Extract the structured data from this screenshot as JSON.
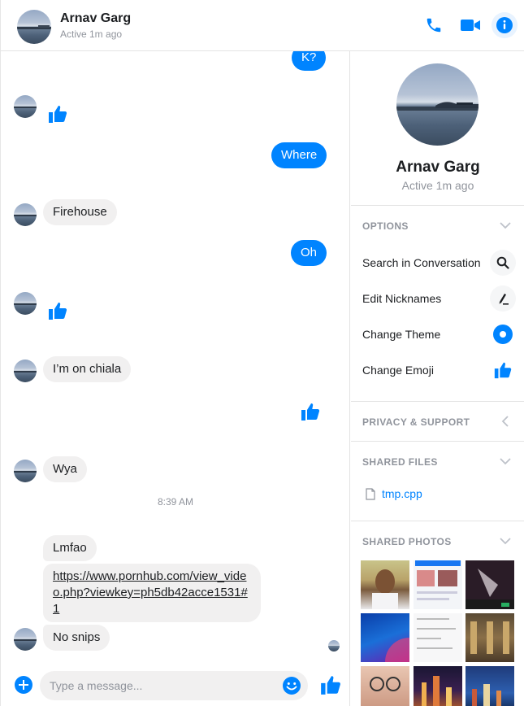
{
  "header": {
    "name": "Arnav Garg",
    "status": "Active 1m ago"
  },
  "messages": {
    "out_k": "K?",
    "out_where": "Where",
    "in_firehouse": "Firehouse",
    "out_oh": "Oh",
    "in_chiala": "I’m on chiala",
    "in_wya": "Wya",
    "timestamp": "8:39 AM",
    "in_lmfao": "Lmfao",
    "in_link": "https://www.pornhub.com/view_video.php?viewkey=ph5db42acce1531#1",
    "in_nosnips": "No snips"
  },
  "composer": {
    "placeholder": "Type a message..."
  },
  "panel": {
    "name": "Arnav Garg",
    "status": "Active 1m ago",
    "options_title": "OPTIONS",
    "options": [
      {
        "label": "Search in Conversation",
        "icon": "search-icon"
      },
      {
        "label": "Edit Nicknames",
        "icon": "pencil-icon"
      },
      {
        "label": "Change Theme",
        "icon": "theme-icon"
      },
      {
        "label": "Change Emoji",
        "icon": "thumbs-up-icon"
      }
    ],
    "privacy_title": "PRIVACY & SUPPORT",
    "files_title": "SHARED FILES",
    "files": [
      {
        "name": "tmp.cpp"
      }
    ],
    "photos_title": "SHARED PHOTOS"
  },
  "colors": {
    "accent": "#0084ff",
    "bubble_in": "#f1f0f0",
    "muted": "#90949c"
  }
}
